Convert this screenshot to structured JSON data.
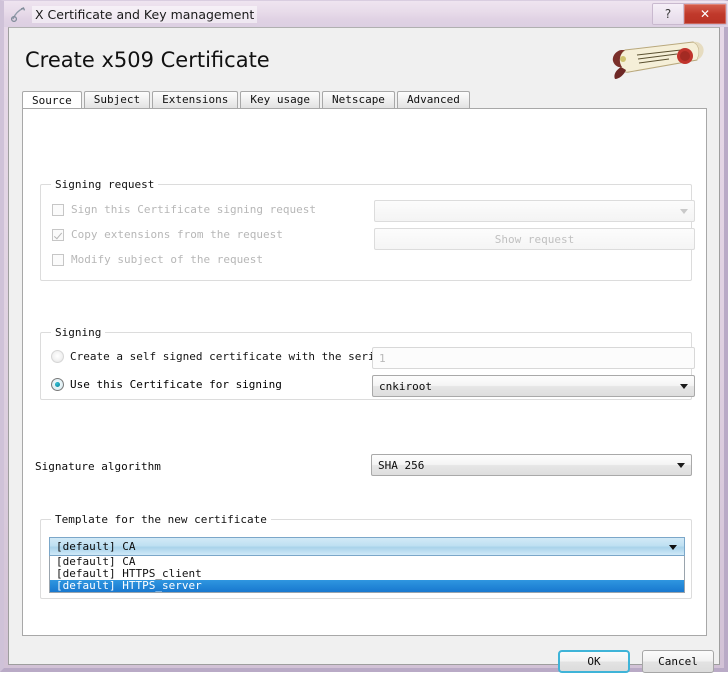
{
  "window": {
    "title": "X Certificate and Key management",
    "icon": "key-certificate-icon",
    "help_button": "?",
    "close_button": "✕"
  },
  "page": {
    "heading": "Create x509 Certificate",
    "logo": "certificate-scroll-seal-logo"
  },
  "tabs": [
    {
      "label": "Source",
      "active": true
    },
    {
      "label": "Subject",
      "active": false
    },
    {
      "label": "Extensions",
      "active": false
    },
    {
      "label": "Key usage",
      "active": false
    },
    {
      "label": "Netscape",
      "active": false
    },
    {
      "label": "Advanced",
      "active": false
    }
  ],
  "signing_request": {
    "group_title": "Signing request",
    "sign_csr": {
      "label": "Sign this Certificate signing request",
      "checked": false,
      "enabled": false
    },
    "copy_extensions": {
      "label": "Copy extensions from the request",
      "checked": true,
      "enabled": false
    },
    "modify_subject": {
      "label": "Modify subject of the request",
      "checked": false,
      "enabled": false
    },
    "request_combo_value": "",
    "show_request_button": "Show request"
  },
  "signing": {
    "group_title": "Signing",
    "self_signed": {
      "label": "Create a self signed certificate with the serial",
      "selected": false
    },
    "serial_value": "1",
    "use_certificate": {
      "label": "Use this Certificate for signing",
      "selected": true
    },
    "certificate_value": "cnkiroot"
  },
  "signature": {
    "label": "Signature algorithm",
    "value": "SHA 256"
  },
  "template": {
    "group_title": "Template for the new certificate",
    "selected_value": "[default] CA",
    "options": [
      {
        "label": "[default] CA",
        "highlighted": false
      },
      {
        "label": "[default] HTTPS_client",
        "highlighted": false
      },
      {
        "label": "[default] HTTPS_server",
        "highlighted": true
      }
    ]
  },
  "footer": {
    "ok_label": "OK",
    "cancel_label": "Cancel"
  },
  "colors": {
    "titlebar": "#e6dae9",
    "close_red": "#c0392b",
    "selection_blue": "#1878cf",
    "combo_hover_blue": "#bfe0f2",
    "radio_accent": "#179aaf",
    "default_button_focus": "#3fb4d8"
  }
}
